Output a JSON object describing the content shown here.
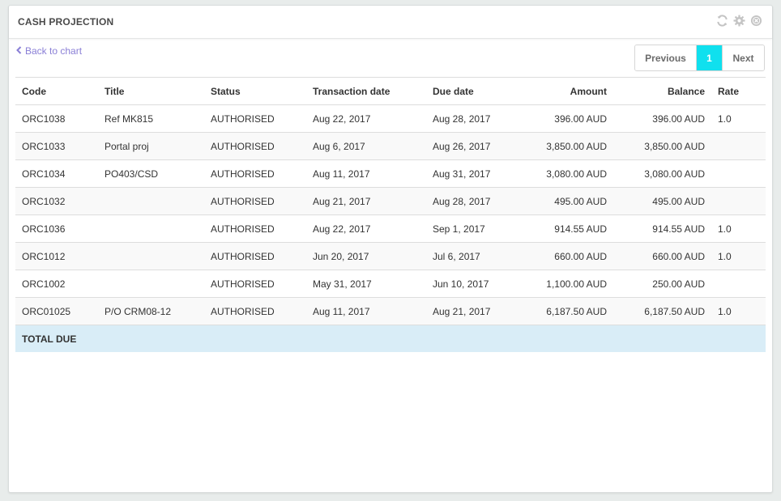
{
  "panel": {
    "title": "CASH PROJECTION",
    "icons": [
      "refresh-icon",
      "gear-icon",
      "close-icon"
    ]
  },
  "back_link": "Back to chart",
  "pagination": {
    "previous": "Previous",
    "current": "1",
    "next": "Next"
  },
  "table": {
    "headers": {
      "code": "Code",
      "title": "Title",
      "status": "Status",
      "transaction_date": "Transaction date",
      "due_date": "Due date",
      "amount": "Amount",
      "balance": "Balance",
      "rate": "Rate"
    },
    "rows": [
      {
        "code": "ORC1038",
        "title": "Ref MK815",
        "status": "AUTHORISED",
        "transaction_date": "Aug 22, 2017",
        "due_date": "Aug 28, 2017",
        "amount": "396.00 AUD",
        "balance": "396.00 AUD",
        "rate": "1.0"
      },
      {
        "code": "ORC1033",
        "title": "Portal proj",
        "status": "AUTHORISED",
        "transaction_date": "Aug 6, 2017",
        "due_date": "Aug 26, 2017",
        "amount": "3,850.00 AUD",
        "balance": "3,850.00 AUD",
        "rate": ""
      },
      {
        "code": "ORC1034",
        "title": "PO403/CSD",
        "status": "AUTHORISED",
        "transaction_date": "Aug 11, 2017",
        "due_date": "Aug 31, 2017",
        "amount": "3,080.00 AUD",
        "balance": "3,080.00 AUD",
        "rate": ""
      },
      {
        "code": "ORC1032",
        "title": "",
        "status": "AUTHORISED",
        "transaction_date": "Aug 21, 2017",
        "due_date": "Aug 28, 2017",
        "amount": "495.00 AUD",
        "balance": "495.00 AUD",
        "rate": ""
      },
      {
        "code": "ORC1036",
        "title": "",
        "status": "AUTHORISED",
        "transaction_date": "Aug 22, 2017",
        "due_date": "Sep 1, 2017",
        "amount": "914.55 AUD",
        "balance": "914.55 AUD",
        "rate": "1.0"
      },
      {
        "code": "ORC1012",
        "title": "",
        "status": "AUTHORISED",
        "transaction_date": "Jun 20, 2017",
        "due_date": "Jul 6, 2017",
        "amount": "660.00 AUD",
        "balance": "660.00 AUD",
        "rate": "1.0"
      },
      {
        "code": "ORC1002",
        "title": "",
        "status": "AUTHORISED",
        "transaction_date": "May 31, 2017",
        "due_date": "Jun 10, 2017",
        "amount": "1,100.00 AUD",
        "balance": "250.00 AUD",
        "rate": ""
      },
      {
        "code": "ORC01025",
        "title": "P/O CRM08-12",
        "status": "AUTHORISED",
        "transaction_date": "Aug 11, 2017",
        "due_date": "Aug 21, 2017",
        "amount": "6,187.50 AUD",
        "balance": "6,187.50 AUD",
        "rate": "1.0"
      }
    ],
    "total_label": "TOTAL DUE"
  },
  "colors": {
    "accent": "#10e0ee",
    "link": "#8a7fd6",
    "total_row": "#d9edf7"
  }
}
